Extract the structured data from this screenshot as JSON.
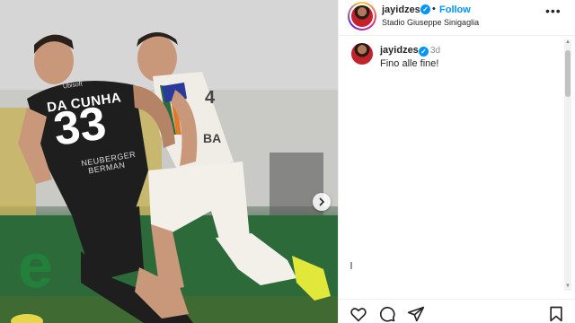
{
  "post": {
    "username": "jayidzes",
    "follow_label": "Follow",
    "separator": "•",
    "location": "Stadio Giuseppe Sinigaglia",
    "more_icon": "more-horizontal-icon"
  },
  "caption": {
    "username": "jayidzes",
    "time": "3d",
    "text": "Fino alle fine!"
  },
  "photo": {
    "jersey_name": "DA CUNHA",
    "jersey_number": "33",
    "sponsor_line1": "NEUBERGER",
    "sponsor_line2": "BERMAN",
    "sponsor_top": "Ubisoft",
    "opponent_name": "BA",
    "opponent_number": "4"
  },
  "colors": {
    "accent": "#0095f6",
    "text": "#262626",
    "muted": "#8e8e8e"
  },
  "icons": [
    "verified-badge-icon",
    "chevron-right-icon",
    "heart-icon",
    "comment-icon",
    "share-icon",
    "bookmark-icon"
  ]
}
